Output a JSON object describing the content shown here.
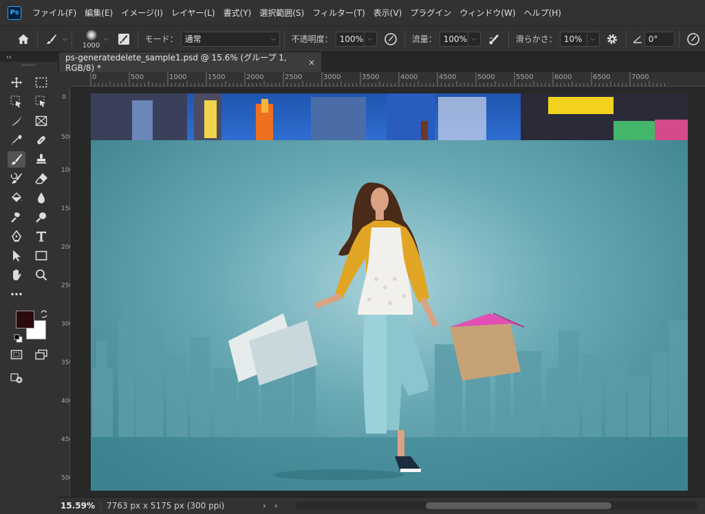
{
  "app": {
    "logo_text": "Ps",
    "accent": "#31a8ff"
  },
  "menu": [
    {
      "label": "ファイル(F)"
    },
    {
      "label": "編集(E)"
    },
    {
      "label": "イメージ(I)"
    },
    {
      "label": "レイヤー(L)"
    },
    {
      "label": "書式(Y)"
    },
    {
      "label": "選択範囲(S)"
    },
    {
      "label": "フィルター(T)"
    },
    {
      "label": "表示(V)"
    },
    {
      "label": "プラグイン"
    },
    {
      "label": "ウィンドウ(W)"
    },
    {
      "label": "ヘルプ(H)"
    }
  ],
  "options": {
    "brush_size": "1000",
    "mode_label": "モード：",
    "mode_value": "通常",
    "opacity_label": "不透明度：",
    "opacity_value": "100%",
    "flow_label": "流量：",
    "flow_value": "100%",
    "smoothing_label": "滑らかさ：",
    "smoothing_value": "10%",
    "angle_value": "0°"
  },
  "tab": {
    "title": "ps-generatedelete_sample1.psd @ 15.6% (グループ 1, RGB/8) *",
    "close": "×"
  },
  "collapse_label": "‹‹",
  "ruler": {
    "top_labels": [
      "500",
      "1000",
      "1500",
      "2000",
      "2500",
      "3000",
      "3500",
      "4000",
      "4500",
      "5000",
      "5500",
      "6000",
      "6500",
      "7000"
    ],
    "left_labels": [
      "0",
      "500",
      "1000",
      "1500",
      "2000",
      "2500",
      "3000",
      "3500",
      "4000",
      "4500",
      "5000"
    ]
  },
  "colors": {
    "foreground": "#2a0a0a",
    "background": "#ffffff"
  },
  "status": {
    "zoom": "15.59%",
    "doc_info": "7763 px x 5175 px (300 ppi)",
    "arrow": "›",
    "scroll_left": "‹"
  }
}
